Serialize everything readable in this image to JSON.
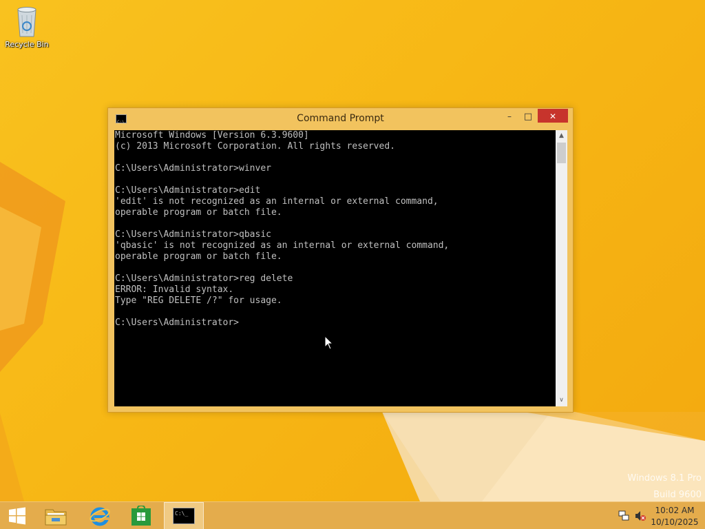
{
  "desktop": {
    "icons": [
      {
        "label": "Recycle Bin",
        "icon": "recycle-bin-icon"
      }
    ],
    "watermark": {
      "line1": "Windows 8.1 Pro",
      "line2": "Build 9600"
    }
  },
  "window": {
    "title": "Command Prompt",
    "icon": "cmd-icon",
    "controls": {
      "minimize": "–",
      "maximize": "□",
      "close": "✕"
    },
    "console_lines": [
      "Microsoft Windows [Version 6.3.9600]",
      "(c) 2013 Microsoft Corporation. All rights reserved.",
      "",
      "C:\\Users\\Administrator>winver",
      "",
      "C:\\Users\\Administrator>edit",
      "'edit' is not recognized as an internal or external command,",
      "operable program or batch file.",
      "",
      "C:\\Users\\Administrator>qbasic",
      "'qbasic' is not recognized as an internal or external command,",
      "operable program or batch file.",
      "",
      "C:\\Users\\Administrator>reg delete",
      "ERROR: Invalid syntax.",
      "Type \"REG DELETE /?\" for usage.",
      "",
      "C:\\Users\\Administrator>"
    ],
    "scrollbar": {
      "up_arrow": "▲",
      "down_arrow": "∨"
    }
  },
  "taskbar": {
    "buttons": [
      {
        "name": "start",
        "icon": "windows-logo-icon"
      },
      {
        "name": "file-explorer",
        "icon": "folder-icon"
      },
      {
        "name": "internet-explorer",
        "icon": "ie-icon"
      },
      {
        "name": "store",
        "icon": "store-icon"
      },
      {
        "name": "command-prompt",
        "icon": "cmd-icon",
        "active": true
      }
    ],
    "tray": {
      "network_icon": "network-icon",
      "volume_icon": "volume-muted-icon"
    },
    "clock": {
      "time": "10:02 AM",
      "date": "10/10/2025"
    }
  },
  "colors": {
    "desktop_bg": "#f6b916",
    "window_frame": "#f2c35e",
    "close_button": "#c7342c",
    "console_bg": "#000000",
    "console_text": "#c0c0c0",
    "taskbar": "#e4ac4c"
  }
}
